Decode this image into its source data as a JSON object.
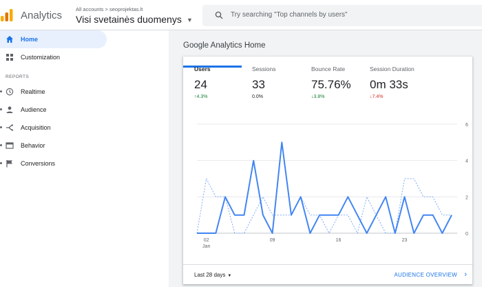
{
  "header": {
    "app_title": "Analytics",
    "account_path": "All accounts > seoprojektas.lt",
    "view_name": "Visi svetainės duomenys",
    "search_placeholder": "Try searching \"Top channels by users\""
  },
  "sidebar": {
    "items": [
      {
        "label": "Home",
        "icon": "home-icon",
        "active": true
      },
      {
        "label": "Customization",
        "icon": "customization-icon"
      }
    ],
    "section": "REPORTS",
    "reports": [
      {
        "label": "Realtime",
        "icon": "clock-icon"
      },
      {
        "label": "Audience",
        "icon": "person-icon"
      },
      {
        "label": "Acquisition",
        "icon": "acquisition-icon"
      },
      {
        "label": "Behavior",
        "icon": "behavior-icon"
      },
      {
        "label": "Conversions",
        "icon": "flag-icon"
      }
    ]
  },
  "main": {
    "title": "Google Analytics Home",
    "metrics": [
      {
        "label": "Users",
        "value": "24",
        "change": "↑4.3%",
        "trend": "up",
        "selected": true
      },
      {
        "label": "Sessions",
        "value": "33",
        "change": "0.0%",
        "trend": "neutral"
      },
      {
        "label": "Bounce Rate",
        "value": "75.76%",
        "change": "↓3.8%",
        "trend": "up"
      },
      {
        "label": "Session Duration",
        "value": "0m 33s",
        "change": "↓7.4%",
        "trend": "down"
      }
    ],
    "date_range": "Last 28 days",
    "overview_link": "AUDIENCE OVERVIEW"
  },
  "colors": {
    "accent": "#1a73e8",
    "line_current": "#4285f4",
    "line_previous": "#7baaf7",
    "positive": "#188038",
    "negative": "#d93025"
  },
  "chart_data": {
    "type": "line",
    "x_tick_labels": [
      "02",
      "09",
      "16",
      "23"
    ],
    "x_tick_sublabel": "Jan",
    "x_tick_indices": [
      1,
      8,
      15,
      22
    ],
    "y_ticks": [
      0,
      2,
      4,
      6
    ],
    "ylim": [
      0,
      6
    ],
    "series": [
      {
        "style": "solid",
        "values": [
          0,
          0,
          0,
          2,
          1,
          1,
          4,
          1,
          0,
          5,
          1,
          2,
          0,
          1,
          1,
          1,
          2,
          1,
          0,
          1,
          2,
          0,
          2,
          0,
          1,
          1,
          0,
          1
        ]
      },
      {
        "style": "dashed",
        "values": [
          0,
          3,
          2,
          2,
          0,
          0,
          1,
          2,
          1,
          1,
          1,
          2,
          1,
          1,
          0,
          1,
          1,
          0,
          2,
          1,
          0,
          0,
          3,
          3,
          2,
          2,
          1,
          1
        ]
      }
    ]
  }
}
